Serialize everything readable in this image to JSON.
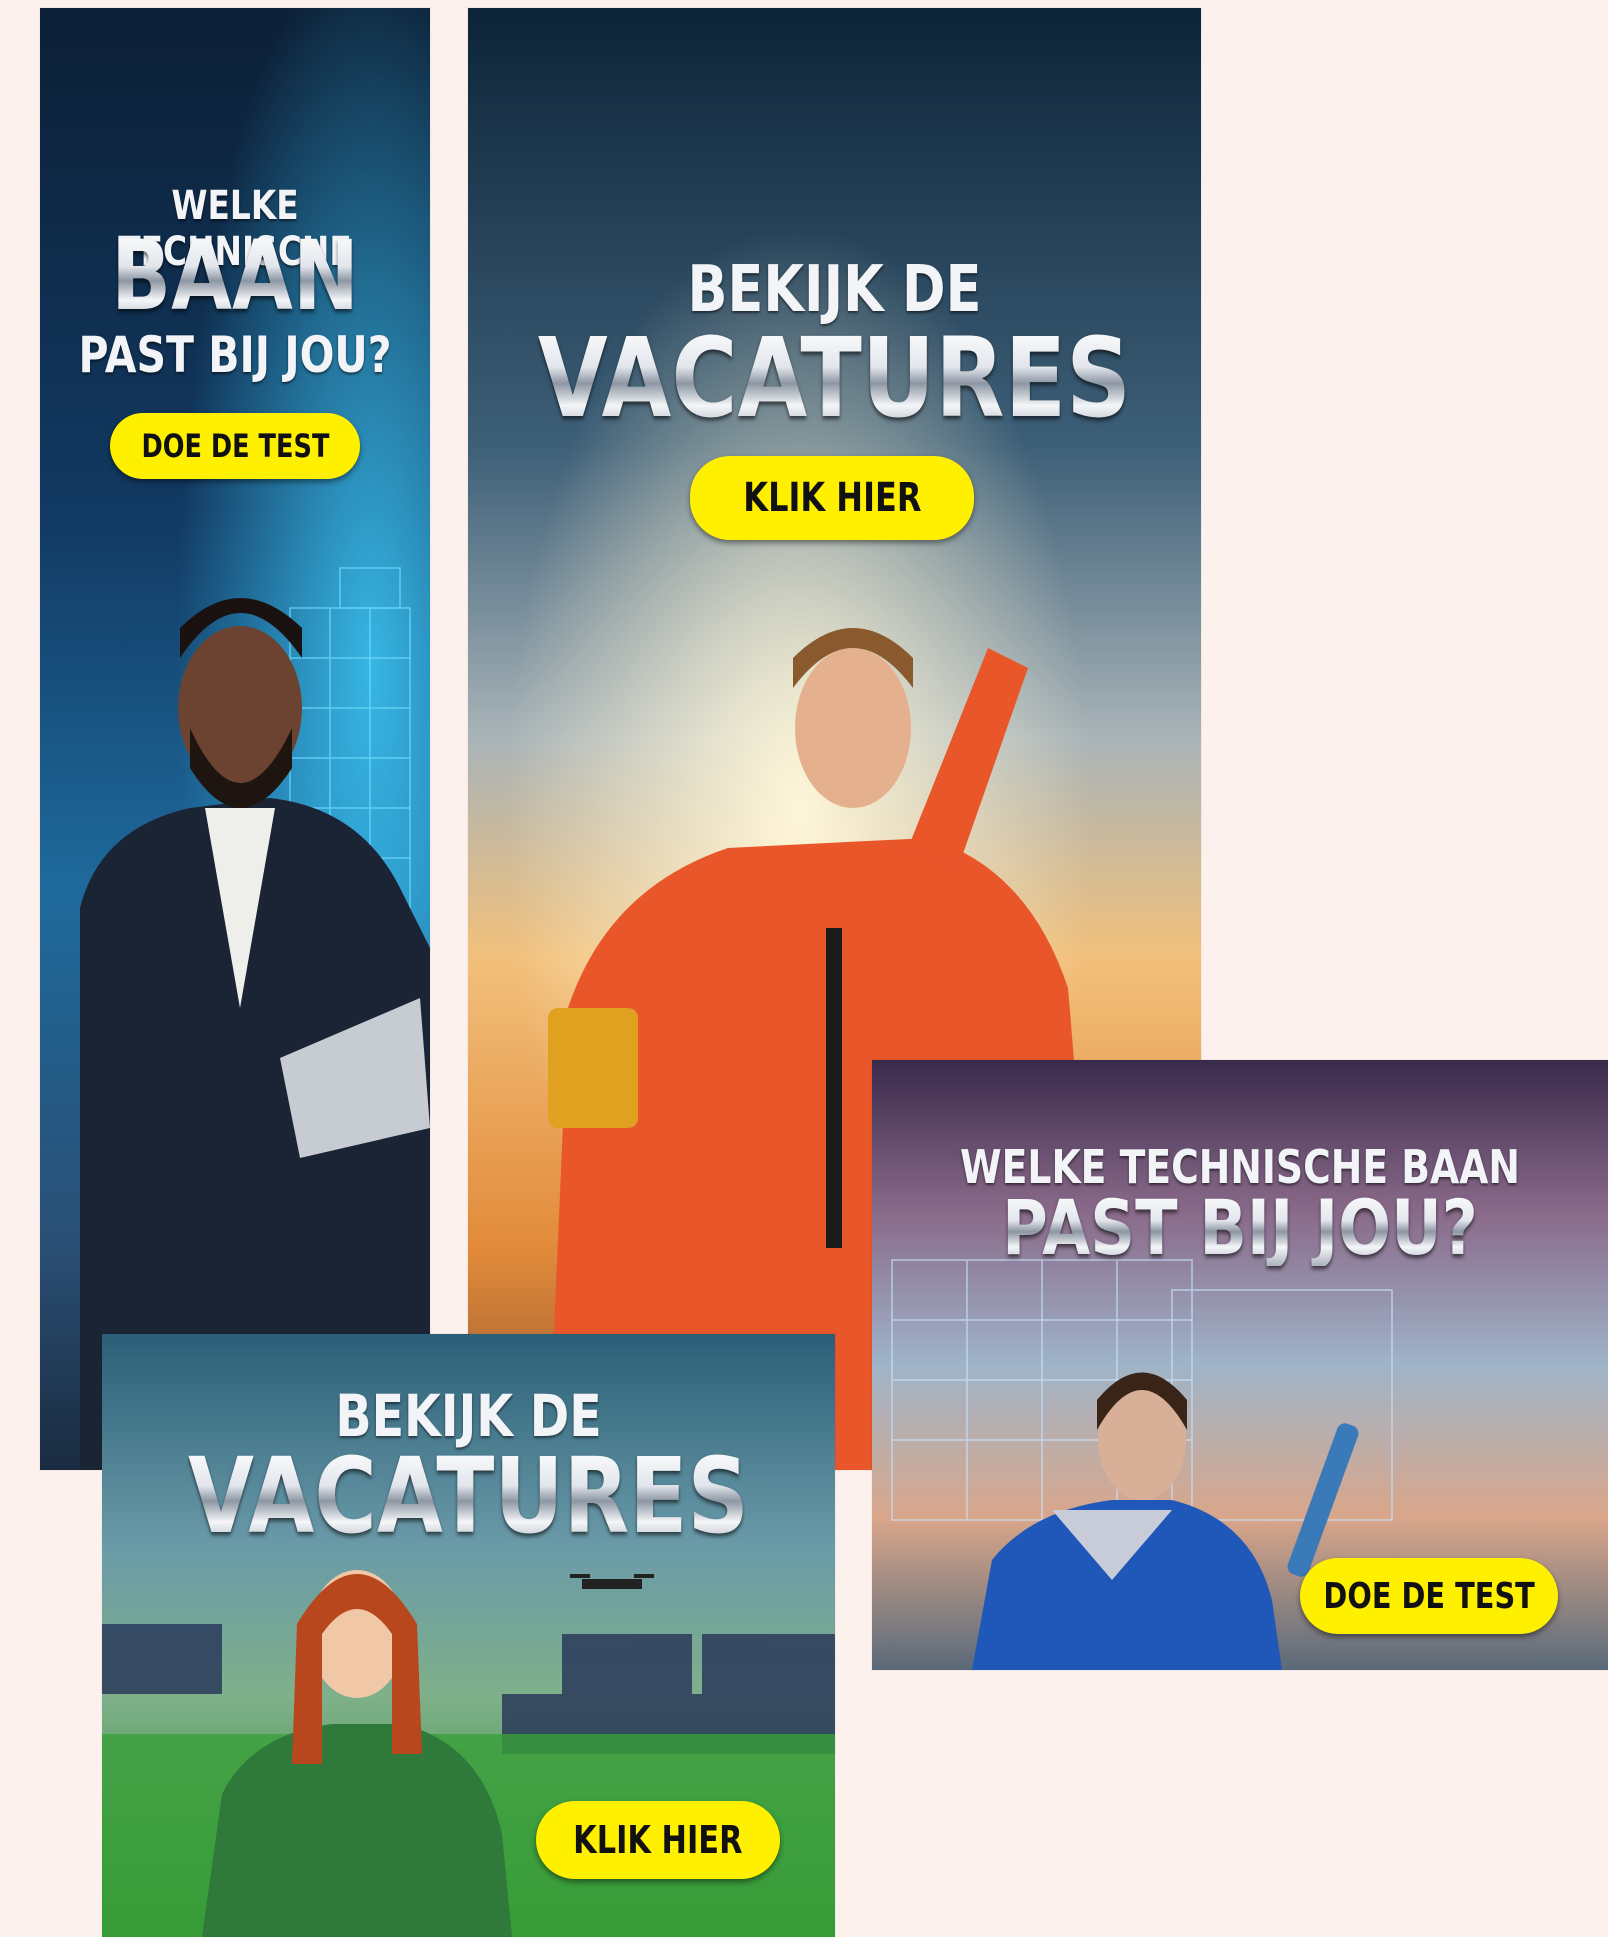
{
  "banners": {
    "skyscraper_left": {
      "line1": "WELKE TECHNISCHE",
      "line2": "BAAN",
      "line3": "PAST BIJ JOU?",
      "cta": "DOE DE TEST"
    },
    "tall_center": {
      "line1": "BEKIJK DE",
      "line2": "VACATURES",
      "cta": "KLIK HIER"
    },
    "square_bottom": {
      "line1": "BEKIJK DE",
      "line2": "VACATURES",
      "cta": "KLIK HIER"
    },
    "rect_right": {
      "line1": "WELKE TECHNISCHE BAAN",
      "line2": "PAST BIJ JOU?",
      "cta": "DOE DE TEST"
    }
  },
  "colors": {
    "page_background": "#fdf1ed",
    "cta_yellow": "#fff000",
    "cta_text": "#111111"
  }
}
